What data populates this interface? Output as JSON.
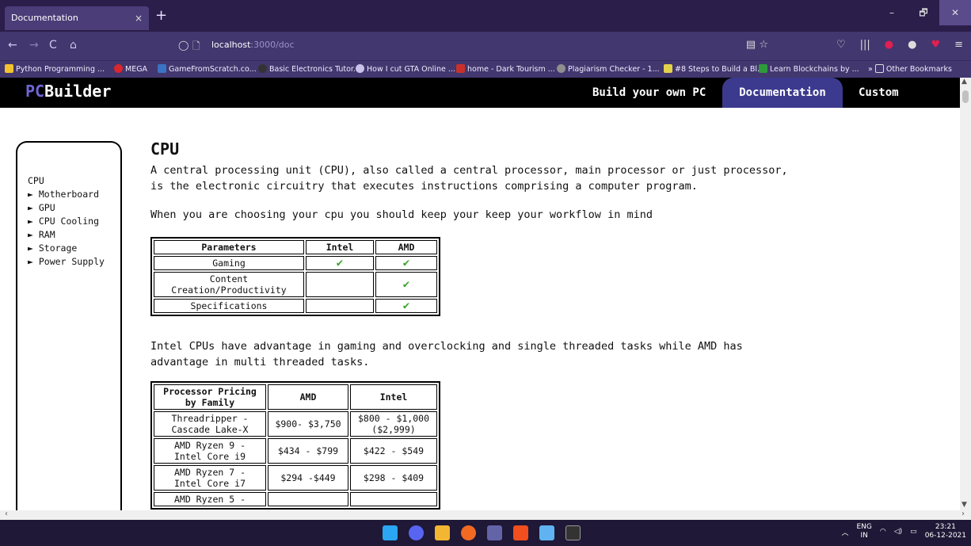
{
  "browser": {
    "tab_title": "Documentation",
    "tab_close": "×",
    "new_tab": "+",
    "url_host": "localhost",
    "url_path": ":3000/doc",
    "window_controls": [
      "–",
      "🗗",
      "✕"
    ]
  },
  "bookmarks": [
    {
      "label": "Python Programming ...",
      "color": "#f2c12e"
    },
    {
      "label": "MEGA",
      "color": "#d9272e"
    },
    {
      "label": "GameFromScratch.co...",
      "color": "#3b73c4"
    },
    {
      "label": "Basic Electronics Tutor...",
      "color": "#333333"
    },
    {
      "label": "How I cut GTA Online ...",
      "color": "#c9c3ea"
    },
    {
      "label": "home - Dark Tourism ...",
      "color": "#c8312b"
    },
    {
      "label": "Plagiarism Checker - 1...",
      "color": "#8f8f8f"
    },
    {
      "label": "#8 Steps to Build a Bl...",
      "color": "#e3d14a"
    },
    {
      "label": "Learn Blockchains by ...",
      "color": "#2f9a3b"
    },
    {
      "label": "Other Bookmarks",
      "color": "#42376e"
    }
  ],
  "header": {
    "logo_pc": "PC",
    "logo_rest": "Builder",
    "nav": [
      "Build your own PC",
      "Documentation",
      "Custom"
    ]
  },
  "sidebar": {
    "items": [
      "CPU",
      "► Motherboard",
      "► GPU",
      "► CPU Cooling",
      "► RAM",
      "► Storage",
      "► Power Supply"
    ]
  },
  "main": {
    "title": "CPU",
    "intro_line1": "A central processing unit (CPU), also called a central processor, main processor or just processor,",
    "intro_line2": "is the electronic circuitry that executes instructions comprising a computer program.",
    "choose": "When you are choosing your cpu you should keep your keep your workflow in mind",
    "adv_line1": "Intel CPUs have advantage in gaming and overclocking and single threaded tasks while AMD has",
    "adv_line2": "advantage in multi threaded tasks."
  },
  "param_table": {
    "headers": [
      "Parameters",
      "Intel",
      "AMD"
    ],
    "rows": [
      {
        "param": "Gaming",
        "intel": "✔",
        "amd": "✔"
      },
      {
        "param_line1": "Content",
        "param_line2": "Creation/Productivity",
        "intel": "",
        "amd": "✔"
      },
      {
        "param": "Specifications",
        "intel": "",
        "amd": "✔"
      }
    ]
  },
  "price_table": {
    "headers": [
      "Processor Pricing",
      "by Family",
      "AMD",
      "Intel"
    ],
    "rows": [
      {
        "family_line1": "Threadripper -",
        "family_line2": "Cascade Lake-X",
        "amd": "$900- $3,750",
        "intel_line1": "$800 - $1,000",
        "intel_line2": "($2,999)"
      },
      {
        "family_line1": "AMD Ryzen 9 -",
        "family_line2": "Intel Core i9",
        "amd": "$434 - $799",
        "intel": "$422 - $549"
      },
      {
        "family_line1": "AMD Ryzen 7 -",
        "family_line2": "Intel Core i7",
        "amd": "$294 -$449",
        "intel": "$298 - $409"
      },
      {
        "family_line1": "AMD Ryzen 5 -",
        "family_line2": "",
        "amd": "",
        "intel": ""
      }
    ]
  },
  "taskbar": {
    "lang_top": "ENG",
    "lang_bottom": "IN",
    "time": "23:21",
    "date": "06-12-2021"
  }
}
